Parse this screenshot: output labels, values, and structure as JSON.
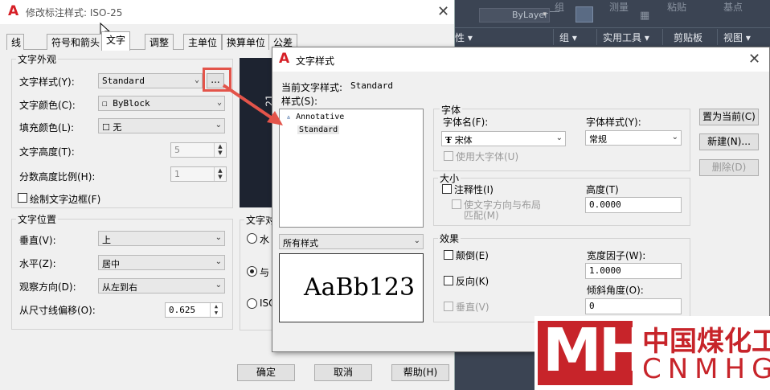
{
  "ribbon": {
    "bylayer": "ByLayer",
    "group_label": "组",
    "measure_label": "测量",
    "paste_label": "粘贴",
    "base_label": "基点",
    "panels": [
      "组 ▾",
      "实用工具 ▾",
      "剪贴板",
      "视图 ▾"
    ],
    "left_label": "性 ▾"
  },
  "dim_dialog": {
    "title": "修改标注样式: ISO-25",
    "tabs": [
      "线",
      "符号和箭头",
      "文字",
      "调整",
      "主单位",
      "换算单位",
      "公差"
    ],
    "appearance_group": "文字外观",
    "text_style_label": "文字样式(Y):",
    "text_style_value": "Standard",
    "browse_button": "...",
    "text_color_label": "文字颜色(C):",
    "text_color_value": "☐ ByBlock",
    "fill_color_label": "填充颜色(L):",
    "fill_color_value": "☐ 无",
    "text_height_label": "文字高度(T):",
    "text_height_value": "5",
    "fraction_scale_label": "分数高度比例(H):",
    "fraction_scale_value": "1",
    "draw_frame_label": "绘制文字边框(F)",
    "placement_group": "文字位置",
    "vertical_label": "垂直(V):",
    "vertical_value": "上",
    "horizontal_label": "水平(Z):",
    "horizontal_value": "居中",
    "view_dir_label": "观察方向(D):",
    "view_dir_value": "从左到右",
    "offset_label": "从尺寸线偏移(O):",
    "offset_value": "0.625",
    "alignment_group": "文字对",
    "align_opt1": "水",
    "align_opt2": "与",
    "align_opt3": "ISO",
    "preview_text": "21",
    "ok_button": "确定",
    "cancel_button": "取消",
    "help_button": "帮助(H)"
  },
  "text_style_dialog": {
    "title": "文字样式",
    "current_style_label": "当前文字样式:",
    "current_style_value": "Standard",
    "styles_label": "样式(S):",
    "styles": [
      "Annotative",
      "Standard"
    ],
    "filter_value": "所有样式",
    "preview_text": "AaBb123",
    "font_group": "字体",
    "font_name_label": "字体名(F):",
    "font_name_value": "宋体",
    "font_style_label": "字体样式(Y):",
    "font_style_value": "常规",
    "bigfont_label": "使用大字体(U)",
    "size_group": "大小",
    "annotative_label": "注释性(I)",
    "match_orient_label1": "使文字方向与布局",
    "match_orient_label2": "匹配(M)",
    "height_label": "高度(T)",
    "height_value": "0.0000",
    "effects_group": "效果",
    "upside_down_label": "颠倒(E)",
    "backwards_label": "反向(K)",
    "vertical_label": "垂直(V)",
    "width_factor_label": "宽度因子(W):",
    "width_factor_value": "1.0000",
    "oblique_label": "倾斜角度(O):",
    "oblique_value": "0",
    "set_current_button": "置为当前(C)",
    "new_button": "新建(N)...",
    "delete_button": "删除(D)"
  },
  "watermark": {
    "logo_text": "MH",
    "cn_text": "中国煤化工",
    "en_text": "CNMHG"
  },
  "colors": {
    "autocad_red": "#d61f26",
    "callout_red": "#e3544a",
    "watermark_red": "#c7242a"
  }
}
